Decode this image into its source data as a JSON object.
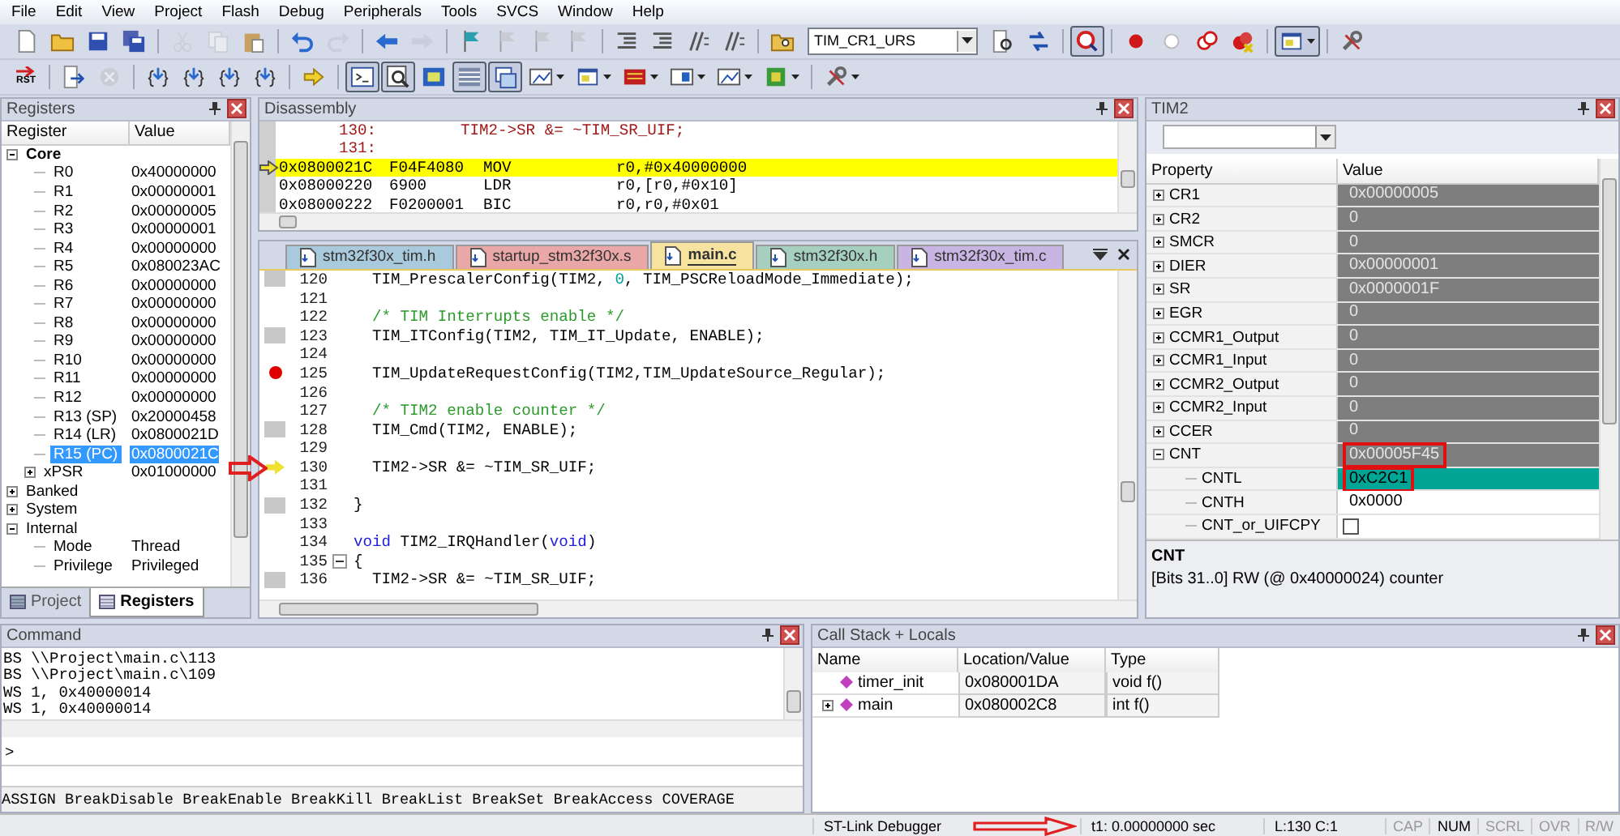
{
  "menu": [
    "File",
    "Edit",
    "View",
    "Project",
    "Flash",
    "Debug",
    "Peripherals",
    "Tools",
    "SVCS",
    "Window",
    "Help"
  ],
  "toolbar_top": [
    {
      "kind": "new",
      "disabled": false,
      "pressed": false,
      "dropdown": false
    },
    {
      "kind": "open",
      "disabled": false,
      "pressed": false,
      "dropdown": false
    },
    {
      "kind": "save",
      "disabled": false,
      "pressed": false,
      "dropdown": false
    },
    {
      "kind": "save-all",
      "disabled": false,
      "pressed": false,
      "dropdown": false
    },
    {
      "kind": "sep"
    },
    {
      "kind": "cut",
      "disabled": true,
      "pressed": false,
      "dropdown": false
    },
    {
      "kind": "copy",
      "disabled": true,
      "pressed": false,
      "dropdown": false
    },
    {
      "kind": "paste",
      "disabled": false,
      "pressed": false,
      "dropdown": false
    },
    {
      "kind": "sep"
    },
    {
      "kind": "undo",
      "disabled": false,
      "pressed": false,
      "dropdown": false
    },
    {
      "kind": "redo",
      "disabled": true,
      "pressed": false,
      "dropdown": false
    },
    {
      "kind": "sep"
    },
    {
      "kind": "back",
      "disabled": false,
      "pressed": false,
      "dropdown": false
    },
    {
      "kind": "forward",
      "disabled": true,
      "pressed": false,
      "dropdown": false
    },
    {
      "kind": "sep"
    },
    {
      "kind": "bookmark",
      "disabled": false,
      "pressed": false,
      "dropdown": false
    },
    {
      "kind": "bookmark",
      "disabled": true,
      "pressed": false,
      "dropdown": false
    },
    {
      "kind": "bookmark",
      "disabled": true,
      "pressed": false,
      "dropdown": false
    },
    {
      "kind": "bookmark",
      "disabled": true,
      "pressed": false,
      "dropdown": false
    },
    {
      "kind": "sep"
    },
    {
      "kind": "indent",
      "disabled": false,
      "pressed": false,
      "dropdown": false
    },
    {
      "kind": "indent",
      "disabled": false,
      "pressed": false,
      "dropdown": false
    },
    {
      "kind": "comment",
      "disabled": false,
      "pressed": false,
      "dropdown": false
    },
    {
      "kind": "comment",
      "disabled": false,
      "pressed": false,
      "dropdown": false
    },
    {
      "kind": "sep"
    },
    {
      "kind": "find-files",
      "disabled": false,
      "pressed": false,
      "dropdown": false
    },
    {
      "kind": "combo",
      "value": "TIM_CR1_URS"
    },
    {
      "kind": "find",
      "disabled": false,
      "pressed": false,
      "dropdown": false
    },
    {
      "kind": "incremental",
      "disabled": false,
      "pressed": false,
      "dropdown": false
    },
    {
      "kind": "sep"
    },
    {
      "kind": "debug",
      "disabled": false,
      "pressed": true,
      "dropdown": false
    },
    {
      "kind": "sep"
    },
    {
      "kind": "breakpoint",
      "disabled": false,
      "pressed": false,
      "dropdown": false
    },
    {
      "kind": "bp-disable",
      "disabled": false,
      "pressed": false,
      "dropdown": false
    },
    {
      "kind": "bp-disable-all",
      "disabled": false,
      "pressed": false,
      "dropdown": false
    },
    {
      "kind": "bp-kill-all",
      "disabled": false,
      "pressed": false,
      "dropdown": false
    },
    {
      "kind": "sep"
    },
    {
      "kind": "window",
      "disabled": false,
      "pressed": true,
      "dropdown": true
    },
    {
      "kind": "sep"
    },
    {
      "kind": "wrench",
      "disabled": false,
      "pressed": false,
      "dropdown": false
    }
  ],
  "toolbar_bottom": [
    {
      "kind": "reset",
      "label": "RST",
      "disabled": false,
      "pressed": false,
      "dropdown": false
    },
    {
      "kind": "sep"
    },
    {
      "kind": "run",
      "disabled": false,
      "pressed": false,
      "dropdown": false
    },
    {
      "kind": "stop",
      "disabled": true,
      "pressed": false,
      "dropdown": false
    },
    {
      "kind": "sep"
    },
    {
      "kind": "step",
      "disabled": false,
      "pressed": false,
      "dropdown": false
    },
    {
      "kind": "step",
      "disabled": false,
      "pressed": false,
      "dropdown": false
    },
    {
      "kind": "step",
      "disabled": false,
      "pressed": false,
      "dropdown": false
    },
    {
      "kind": "step",
      "disabled": false,
      "pressed": false,
      "dropdown": false
    },
    {
      "kind": "sep"
    },
    {
      "kind": "show-next",
      "disabled": false,
      "pressed": false,
      "dropdown": false
    },
    {
      "kind": "sep"
    },
    {
      "kind": "command",
      "disabled": false,
      "pressed": true,
      "dropdown": false
    },
    {
      "kind": "disasm",
      "disabled": false,
      "pressed": true,
      "dropdown": false
    },
    {
      "kind": "symbols",
      "disabled": false,
      "pressed": false,
      "dropdown": false
    },
    {
      "kind": "registers",
      "disabled": false,
      "pressed": true,
      "dropdown": false
    },
    {
      "kind": "callstack",
      "disabled": false,
      "pressed": true,
      "dropdown": false
    },
    {
      "kind": "watch",
      "disabled": false,
      "pressed": false,
      "dropdown": true
    },
    {
      "kind": "window",
      "disabled": false,
      "pressed": false,
      "dropdown": true
    },
    {
      "kind": "memory",
      "disabled": false,
      "pressed": false,
      "dropdown": true
    },
    {
      "kind": "serial",
      "disabled": false,
      "pressed": false,
      "dropdown": true
    },
    {
      "kind": "watch",
      "disabled": false,
      "pressed": false,
      "dropdown": true
    },
    {
      "kind": "chip",
      "disabled": false,
      "pressed": false,
      "dropdown": true
    },
    {
      "kind": "sep"
    },
    {
      "kind": "wrench",
      "disabled": false,
      "pressed": false,
      "dropdown": true
    }
  ],
  "registers": {
    "title": "Registers",
    "columns": [
      "Register",
      "Value"
    ],
    "tree": [
      {
        "name": "Core",
        "selected": false,
        "expanded": true,
        "children": [
          {
            "name": "R0",
            "value": "0x40000000",
            "selected": false
          },
          {
            "name": "R1",
            "value": "0x00000001",
            "selected": false
          },
          {
            "name": "R2",
            "value": "0x00000005",
            "selected": false
          },
          {
            "name": "R3",
            "value": "0x00000001",
            "selected": false
          },
          {
            "name": "R4",
            "value": "0x00000000",
            "selected": false
          },
          {
            "name": "R5",
            "value": "0x080023AC",
            "selected": false
          },
          {
            "name": "R6",
            "value": "0x00000000",
            "selected": false
          },
          {
            "name": "R7",
            "value": "0x00000000",
            "selected": false
          },
          {
            "name": "R8",
            "value": "0x00000000",
            "selected": false
          },
          {
            "name": "R9",
            "value": "0x00000000",
            "selected": false
          },
          {
            "name": "R10",
            "value": "0x00000000",
            "selected": false
          },
          {
            "name": "R11",
            "value": "0x00000000",
            "selected": false
          },
          {
            "name": "R12",
            "value": "0x00000000",
            "selected": false
          },
          {
            "name": "R13 (SP)",
            "value": "0x20000458",
            "selected": false
          },
          {
            "name": "R14 (LR)",
            "value": "0x0800021D",
            "selected": false
          },
          {
            "name": "R15 (PC)",
            "value": "0x0800021C",
            "selected": true
          },
          {
            "name": "xPSR",
            "value": "0x01000000",
            "selected": false,
            "expanded": false
          }
        ]
      },
      {
        "name": "Banked",
        "selected": false,
        "expanded": false
      },
      {
        "name": "System",
        "selected": false,
        "expanded": false
      },
      {
        "name": "Internal",
        "selected": false,
        "expanded": true,
        "children": [
          {
            "name": "Mode",
            "value": "Thread",
            "selected": false
          },
          {
            "name": "Privilege",
            "value": "Privileged",
            "selected": false
          }
        ]
      }
    ],
    "tabs": [
      {
        "label": "Project",
        "selected": false
      },
      {
        "label": "Registers",
        "selected": true
      }
    ]
  },
  "disassembly": {
    "title": "Disassembly",
    "lines": [
      {
        "kind": "source",
        "number": "130:",
        "code": "TIM2->SR &= ~TIM_SR_UIF;"
      },
      {
        "kind": "source",
        "number": "131:"
      },
      {
        "kind": "asm",
        "address": "0x0800021C",
        "opcode": "F04F4080",
        "mnemonic": "MOV",
        "operands": "r0,#0x40000000",
        "current": true
      },
      {
        "kind": "asm",
        "address": "0x08000220",
        "opcode": "6900",
        "mnemonic": "LDR",
        "operands": "r0,[r0,#0x10]",
        "current": false
      },
      {
        "kind": "asm",
        "address": "0x08000222",
        "opcode": "F0200001",
        "mnemonic": "BIC",
        "operands": "r0,r0,#0x01",
        "current": false
      }
    ]
  },
  "editor": {
    "tabs": [
      {
        "label": "stm32f30x_tim.h",
        "color": "#a9c9dc",
        "selected": false
      },
      {
        "label": "startup_stm32f30x.s",
        "color": "#eaa7a7",
        "selected": false
      },
      {
        "label": "main.c",
        "color": "#f7e3a0",
        "selected": true
      },
      {
        "label": "stm32f30x.h",
        "color": "#a5d0c0",
        "selected": false
      },
      {
        "label": "stm32f30x_tim.c",
        "color": "#c9b5e3",
        "selected": false
      }
    ],
    "lines": [
      {
        "number": "120",
        "mark": true,
        "breakpoint": false,
        "current": false,
        "code": [
          {
            "kind": "plain",
            "text": "  TIM_PrescalerConfig(TIM2, "
          },
          {
            "kind": "number",
            "text": "0"
          },
          {
            "kind": "plain",
            "text": ", TIM_PSCReloadMode_Immediate);"
          }
        ]
      },
      {
        "number": "121",
        "mark": false,
        "breakpoint": false,
        "current": false
      },
      {
        "number": "122",
        "mark": false,
        "breakpoint": false,
        "current": false,
        "code": [
          {
            "kind": "comment",
            "text": "  /* TIM Interrupts enable */"
          }
        ]
      },
      {
        "number": "123",
        "mark": true,
        "breakpoint": false,
        "current": false,
        "code": [
          {
            "kind": "plain",
            "text": "  TIM_ITConfig(TIM2, TIM_IT_Update, ENABLE);"
          }
        ]
      },
      {
        "number": "124",
        "mark": false,
        "breakpoint": false,
        "current": false
      },
      {
        "number": "125",
        "mark": true,
        "breakpoint": true,
        "current": false,
        "code": [
          {
            "kind": "plain",
            "text": "  TIM_UpdateRequestConfig(TIM2,TIM_UpdateSource_Regular);"
          }
        ]
      },
      {
        "number": "126",
        "mark": false,
        "breakpoint": false,
        "current": false
      },
      {
        "number": "127",
        "mark": false,
        "breakpoint": false,
        "current": false,
        "code": [
          {
            "kind": "comment",
            "text": "  /* TIM2 enable counter */"
          }
        ]
      },
      {
        "number": "128",
        "mark": true,
        "breakpoint": false,
        "current": false,
        "code": [
          {
            "kind": "plain",
            "text": "  TIM_Cmd(TIM2, ENABLE);"
          }
        ]
      },
      {
        "number": "129",
        "mark": false,
        "breakpoint": false,
        "current": false
      },
      {
        "number": "130",
        "mark": true,
        "breakpoint": false,
        "current": true,
        "code": [
          {
            "kind": "plain",
            "text": "  TIM2->SR &= ~TIM_SR_UIF;"
          }
        ]
      },
      {
        "number": "131",
        "mark": false,
        "breakpoint": false,
        "current": false
      },
      {
        "number": "132",
        "mark": true,
        "breakpoint": false,
        "current": false,
        "code": [
          {
            "kind": "plain",
            "text": "}"
          }
        ]
      },
      {
        "number": "133",
        "mark": false,
        "breakpoint": false,
        "current": false
      },
      {
        "number": "134",
        "mark": false,
        "breakpoint": false,
        "current": false,
        "code": [
          {
            "kind": "keyword",
            "text": "void"
          },
          {
            "kind": "plain",
            "text": " TIM2_IRQHandler("
          },
          {
            "kind": "keyword",
            "text": "void"
          },
          {
            "kind": "plain",
            "text": ")"
          }
        ]
      },
      {
        "number": "135",
        "mark": false,
        "breakpoint": false,
        "current": false,
        "fold": true,
        "code": [
          {
            "kind": "plain",
            "text": "{"
          }
        ]
      },
      {
        "number": "136",
        "mark": true,
        "breakpoint": false,
        "current": false,
        "code": [
          {
            "kind": "plain",
            "text": "  TIM2->SR &= ~TIM_SR_UIF;"
          }
        ]
      }
    ]
  },
  "peripheral": {
    "title": "TIM2",
    "columns": [
      "Property",
      "Value"
    ],
    "rows": [
      {
        "name": "CR1",
        "value": "0x00000005",
        "kind": "register",
        "expanded": false,
        "changed": false,
        "boxed": false
      },
      {
        "name": "CR2",
        "value": "0",
        "kind": "register",
        "expanded": false,
        "changed": false,
        "boxed": false
      },
      {
        "name": "SMCR",
        "value": "0",
        "kind": "register",
        "expanded": false,
        "changed": false,
        "boxed": false
      },
      {
        "name": "DIER",
        "value": "0x00000001",
        "kind": "register",
        "expanded": false,
        "changed": false,
        "boxed": false
      },
      {
        "name": "SR",
        "value": "0x0000001F",
        "kind": "register",
        "expanded": false,
        "changed": false,
        "boxed": false
      },
      {
        "name": "EGR",
        "value": "0",
        "kind": "register",
        "expanded": false,
        "changed": false,
        "boxed": false
      },
      {
        "name": "CCMR1_Output",
        "value": "0",
        "kind": "register",
        "expanded": false,
        "changed": false,
        "boxed": false
      },
      {
        "name": "CCMR1_Input",
        "value": "0",
        "kind": "register",
        "expanded": false,
        "changed": false,
        "boxed": false
      },
      {
        "name": "CCMR2_Output",
        "value": "0",
        "kind": "register",
        "expanded": false,
        "changed": false,
        "boxed": false
      },
      {
        "name": "CCMR2_Input",
        "value": "0",
        "kind": "register",
        "expanded": false,
        "changed": false,
        "boxed": false
      },
      {
        "name": "CCER",
        "value": "0",
        "kind": "register",
        "expanded": false,
        "changed": false,
        "boxed": false
      },
      {
        "name": "CNT",
        "value": "0x00005F45",
        "kind": "register",
        "expanded": true,
        "changed": false,
        "boxed": true,
        "children": [
          {
            "name": "CNTL",
            "value": "0xC2C1",
            "kind": "field",
            "changed": true,
            "boxed": true
          },
          {
            "name": "CNTH",
            "value": "0x0000",
            "kind": "field",
            "changed": false,
            "boxed": false
          },
          {
            "name": "CNT_or_UIFCPY",
            "kind": "checkbox",
            "checked": false,
            "changed": false,
            "boxed": false
          }
        ]
      }
    ],
    "description": {
      "title": "CNT",
      "text": "[Bits 31..0] RW (@ 0x40000024) counter"
    }
  },
  "command": {
    "title": "Command",
    "lines": [
      "BS \\\\Project\\main.c\\113",
      "BS \\\\Project\\main.c\\109",
      "WS 1, 0x40000014",
      "WS 1, 0x40000014"
    ],
    "prompt": ">",
    "keywords": "ASSIGN BreakDisable BreakEnable BreakKill BreakList BreakSet BreakAccess COVERAGE"
  },
  "call_stack": {
    "title": "Call Stack + Locals",
    "columns": [
      "Name",
      "Location/Value",
      "Type"
    ],
    "rows": [
      {
        "name": "timer_init",
        "location": "0x080001DA",
        "type": "void f()",
        "expandable": false
      },
      {
        "name": "main",
        "location": "0x080002C8",
        "type": "int f()",
        "expandable": true
      }
    ]
  },
  "status_bar": {
    "debugger": "ST-Link Debugger",
    "time": "t1: 0.00000000 sec",
    "position": "L:130 C:1",
    "indicators": [
      {
        "label": "CAP",
        "on": false
      },
      {
        "label": "NUM",
        "on": true
      },
      {
        "label": "SCRL",
        "on": false
      },
      {
        "label": "OVR",
        "on": false
      },
      {
        "label": "R/W",
        "on": false
      }
    ]
  }
}
